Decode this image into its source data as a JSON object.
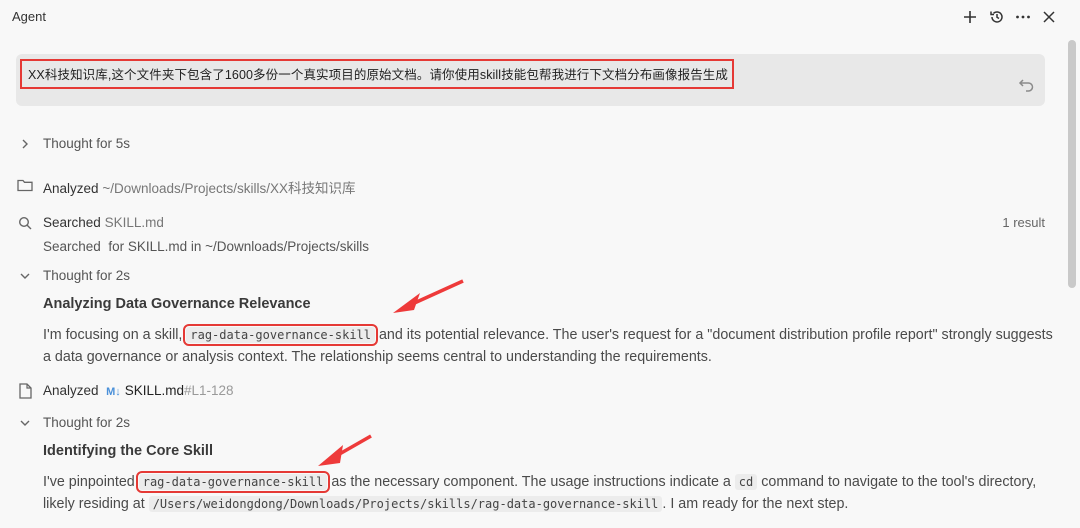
{
  "header": {
    "title": "Agent",
    "icons": [
      "plus-icon",
      "history-icon",
      "more-icon",
      "close-icon"
    ]
  },
  "prompt": {
    "text": "XX科技知识库,这个文件夹下包含了1600多份一个真实项目的原始文档。请你使用skill技能包帮我进行下文档分布画像报告生成"
  },
  "steps": {
    "thought1": "Thought for 5s",
    "analyzed1_label": "Analyzed",
    "analyzed1_path": "~/Downloads/Projects/skills/XX科技知识库",
    "searched_label": "Searched",
    "searched_file": "SKILL.md",
    "searched_result": "1 result",
    "searched_detail_a": "Searched",
    "searched_detail_b": "for SKILL.md in ~/Downloads/Projects/skills",
    "thought2": "Thought for 2s",
    "heading1": "Analyzing Data Governance Relevance",
    "para1_a": "I'm focusing on a skill, ",
    "para1_code": "rag-data-governance-skill",
    "para1_b": " and its potential relevance. The user's request for a \"document distribution profile report\" strongly suggests a data governance or analysis context. The relationship seems central to understanding the requirements.",
    "analyzed2_label": "Analyzed",
    "analyzed2_badge": "M↓",
    "analyzed2_file": "SKILL.md",
    "analyzed2_range": "#L1-128",
    "thought3": "Thought for 2s",
    "heading2": "Identifying the Core Skill",
    "para2_a": "I've pinpointed ",
    "para2_code": "rag-data-governance-skill",
    "para2_b": " as the necessary component. The usage instructions indicate a ",
    "para2_code2": "cd",
    "para2_c": " command to navigate to the tool's directory, likely residing at ",
    "para2_code3": "/Users/weidongdong/Downloads/Projects/skills/rag-data-governance-skill",
    "para2_d": ". I am ready for the next step."
  },
  "colors": {
    "highlight": "#e53935",
    "background": "#f8f8f8",
    "prompt_bg": "#e8e8e8"
  }
}
